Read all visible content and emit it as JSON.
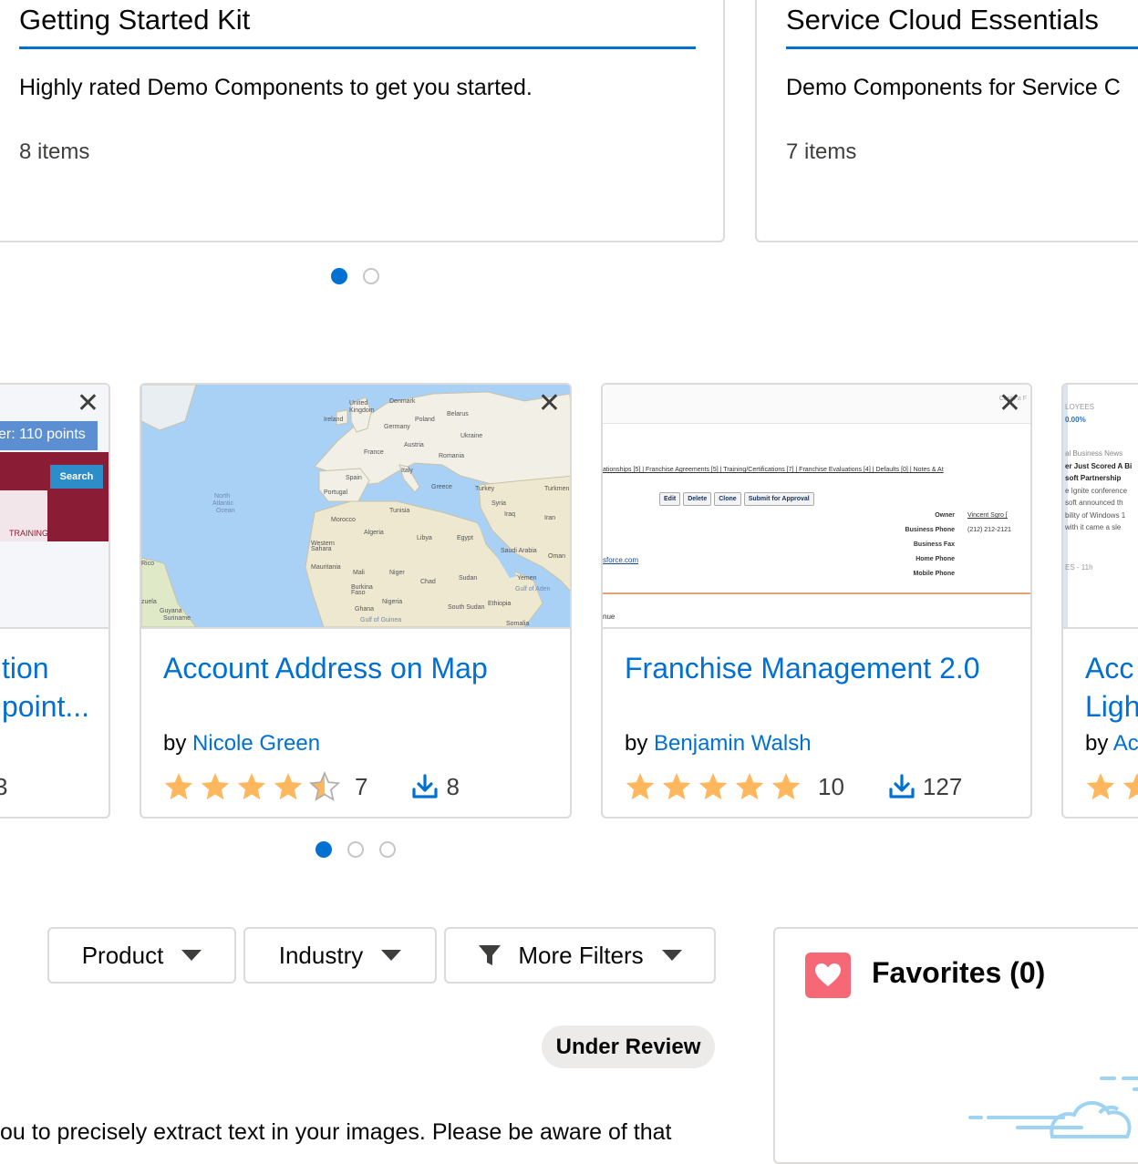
{
  "collections": [
    {
      "title": "Getting Started Kit",
      "description": "Highly rated Demo Components to get you started.",
      "count": "8 items"
    },
    {
      "title": "Service Cloud Essentials",
      "description": "Demo Components for Service C",
      "count": "7 items"
    }
  ],
  "demo_cards": {
    "left_partial": {
      "title_line1": "tion",
      "title_line2": "point...",
      "count_fragment": "3",
      "thumb_banner": "er: 110 points",
      "thumb_search": "Search",
      "thumb_tag": "TRAINING"
    },
    "account_map": {
      "title": "Account Address on Map",
      "by": "by",
      "author": "Nicole Green",
      "rating": 4.5,
      "rating_count": "7",
      "downloads": "8",
      "map_labels": {
        "ocean": "North Atlantic Ocean",
        "countries": [
          "United Kingdom",
          "Ireland",
          "Denmark",
          "Poland",
          "Belarus",
          "Germany",
          "Ukraine",
          "France",
          "Austria",
          "Romania",
          "Spain",
          "Italy",
          "Portugal",
          "Greece",
          "Turkey",
          "Syria",
          "Iraq",
          "Iran",
          "Tunisia",
          "Morocco",
          "Algeria",
          "Libya",
          "Egypt",
          "Saudi Arabia",
          "Western Sahara",
          "Mauritania",
          "Mali",
          "Niger",
          "Chad",
          "Sudan",
          "Yemen",
          "Oman",
          "Burkina Faso",
          "Nigeria",
          "Ghana",
          "South Sudan",
          "Ethiopia",
          "Somalia",
          "Guyana",
          "Suriname",
          "Rico",
          "zuela",
          "Gulf of Guinea",
          "Gulf of Aden",
          "Turkmen"
        ]
      }
    },
    "franchise": {
      "title": "Franchise Management 2.0",
      "by": "by",
      "author": "Benjamin Walsh",
      "rating": 5,
      "rating_count": "10",
      "downloads": "127",
      "thumb": {
        "top_right": "Custo a F",
        "related_links": "ationships [5] | Franchise Agreements [5] | Training/Certifications [7] | Franchise Evaluations [4] | Defaults [0] | Notes & At",
        "buttons": [
          "Edit",
          "Delete",
          "Clone",
          "Submit for Approval"
        ],
        "fields": [
          {
            "label": "Owner",
            "value": "Vincent Sgro ["
          },
          {
            "label": "Business Phone",
            "value": "(212) 212-2121"
          },
          {
            "label": "Business Fax",
            "value": ""
          },
          {
            "label": "Home Phone",
            "value": ""
          },
          {
            "label": "Mobile Phone",
            "value": ""
          }
        ],
        "link": "sforce.com",
        "bottom": "nue"
      }
    },
    "right_partial": {
      "title_line1": "Acc",
      "title_line2": "Ligh",
      "by": "by",
      "author_fragment": "Ac",
      "thumb_lines": [
        "LOYEES",
        "0.00%",
        "al Business News",
        "er Just Scored A Bi",
        "soft Partnership",
        "e Ignite conference",
        "soft announced th",
        "bility of Windows 1",
        "with it came a sle",
        "ES - 11h"
      ]
    }
  },
  "filters": {
    "product": "Product",
    "industry": "Industry",
    "more_filters": "More Filters"
  },
  "status_pill": "Under Review",
  "favorites": {
    "title": "Favorites (0)"
  },
  "bottom_text": "ou to precisely extract text in your images. Please be aware of that",
  "colors": {
    "brand_blue": "#0070d2",
    "star": "#ffb75d",
    "favorites_icon": "#f76877",
    "border": "#dddbda"
  }
}
